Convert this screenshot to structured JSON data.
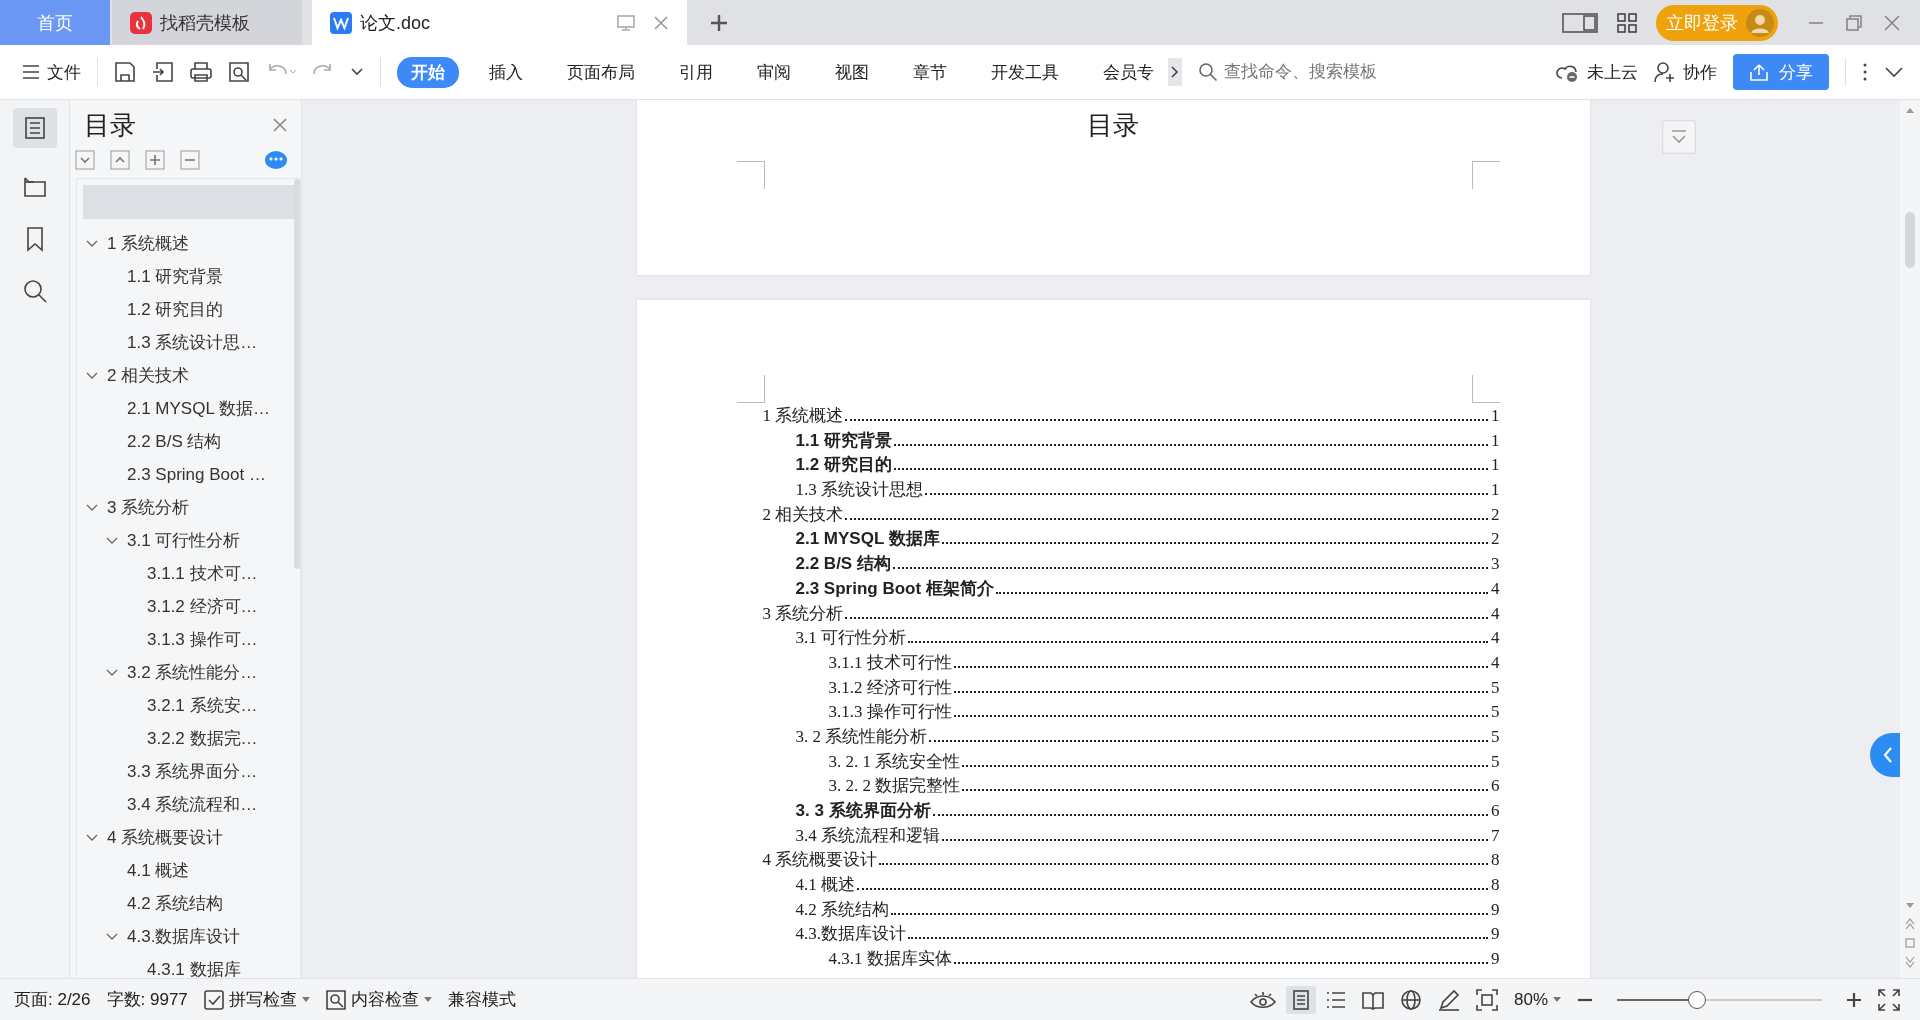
{
  "tabs": [
    {
      "label": "首页",
      "kind": "home",
      "selected": false
    },
    {
      "label": "找稻壳模板",
      "kind": "docer",
      "selected": false
    },
    {
      "label": "论文.doc",
      "kind": "doc",
      "selected": true
    }
  ],
  "login_button": "立即登录",
  "toolbar": {
    "file_menu": "文件",
    "ribbon_tabs": [
      {
        "label": "开始",
        "selected": true
      },
      {
        "label": "插入",
        "selected": false
      },
      {
        "label": "页面布局",
        "selected": false
      },
      {
        "label": "引用",
        "selected": false
      },
      {
        "label": "审阅",
        "selected": false
      },
      {
        "label": "视图",
        "selected": false
      },
      {
        "label": "章节",
        "selected": false
      },
      {
        "label": "开发工具",
        "selected": false
      },
      {
        "label": "会员专",
        "selected": false
      }
    ],
    "search": {
      "placeholder": "查找命令、搜索模板"
    },
    "cloud": "未上云",
    "collaborate": "协作",
    "share": "分享"
  },
  "sidebar": {
    "title": "目录",
    "items": [
      {
        "label": "1 系统概述",
        "expanded": true,
        "children": [
          {
            "label": "1.1  研究背景"
          },
          {
            "label": "1.2 研究目的"
          },
          {
            "label": "1.3 系统设计思…"
          }
        ]
      },
      {
        "label": "2 相关技术",
        "expanded": true,
        "children": [
          {
            "label": "2.1 MYSQL 数据…"
          },
          {
            "label": "2.2 B/S 结构"
          },
          {
            "label": "2.3 Spring Boot …"
          }
        ]
      },
      {
        "label": "3 系统分析",
        "expanded": true,
        "children": [
          {
            "label": "3.1 可行性分析",
            "expanded": true,
            "children": [
              {
                "label": "3.1.1 技术可…"
              },
              {
                "label": "3.1.2 经济可…"
              },
              {
                "label": "3.1.3 操作可…"
              }
            ]
          },
          {
            "label": "3.2 系统性能分…",
            "expanded": true,
            "children": [
              {
                "label": "3.2.1  系统安…"
              },
              {
                "label": "3.2.2  数据完…"
              }
            ]
          },
          {
            "label": "3.3 系统界面分…"
          },
          {
            "label": "3.4 系统流程和…"
          }
        ]
      },
      {
        "label": "4 系统概要设计",
        "expanded": true,
        "children": [
          {
            "label": "4.1 概述"
          },
          {
            "label": "4.2 系统结构"
          },
          {
            "label": "4.3.数据库设计",
            "expanded": true,
            "children": [
              {
                "label": "4.3.1 数据库"
              }
            ]
          }
        ]
      }
    ]
  },
  "document": {
    "page_heading": "目录",
    "toc": [
      {
        "title": "1 系统概述",
        "page": "1",
        "bold": false,
        "children": [
          {
            "title": "1.1  研究背景",
            "page": "1",
            "bold": true
          },
          {
            "title": "1.2 研究目的",
            "page": "1",
            "bold": true
          },
          {
            "title": "1.3 系统设计思想",
            "page": "1",
            "bold": false
          }
        ]
      },
      {
        "title": "2 相关技术",
        "page": "2",
        "bold": false,
        "children": [
          {
            "title": "2.1 MYSQL 数据库",
            "page": "2",
            "bold": true
          },
          {
            "title": "2.2 B/S 结构",
            "page": "3",
            "bold": true
          },
          {
            "title": "2.3 Spring Boot 框架简介",
            "page": "4",
            "bold": true
          }
        ]
      },
      {
        "title": "3 系统分析",
        "page": "4",
        "bold": false,
        "children": [
          {
            "title": "3.1 可行性分析",
            "page": "4",
            "bold": false,
            "children": [
              {
                "title": "3.1.1 技术可行性",
                "page": "4",
                "bold": false
              },
              {
                "title": "3.1.2 经济可行性",
                "page": "5",
                "bold": false
              },
              {
                "title": "3.1.3 操作可行性",
                "page": "5",
                "bold": false
              }
            ]
          },
          {
            "title": "3. 2 系统性能分析",
            "page": "5",
            "bold": false,
            "children": [
              {
                "title": "3. 2. 1  系统安全性",
                "page": "5",
                "bold": false
              },
              {
                "title": "3. 2. 2  数据完整性",
                "page": "6",
                "bold": false
              }
            ]
          },
          {
            "title": "3. 3 系统界面分析",
            "page": "6",
            "bold": true
          },
          {
            "title": "3.4 系统流程和逻辑",
            "page": "7",
            "bold": false
          }
        ]
      },
      {
        "title": "4 系统概要设计",
        "page": "8",
        "bold": false,
        "children": [
          {
            "title": "4.1 概述",
            "page": "8",
            "bold": false
          },
          {
            "title": "4.2 系统结构",
            "page": "9",
            "bold": false
          },
          {
            "title": "4.3.数据库设计",
            "page": "9",
            "bold": false,
            "children": [
              {
                "title": "4.3.1 数据库实体",
                "page": "9",
                "bold": false
              }
            ]
          }
        ]
      }
    ]
  },
  "status_bar": {
    "page": "页面: 2/26",
    "words": "字数: 9977",
    "spell_check": "拼写检查",
    "content_check": "内容检查",
    "compat_mode": "兼容模式",
    "zoom": "80%",
    "zoom_slider": {
      "level": 0.39
    }
  }
}
